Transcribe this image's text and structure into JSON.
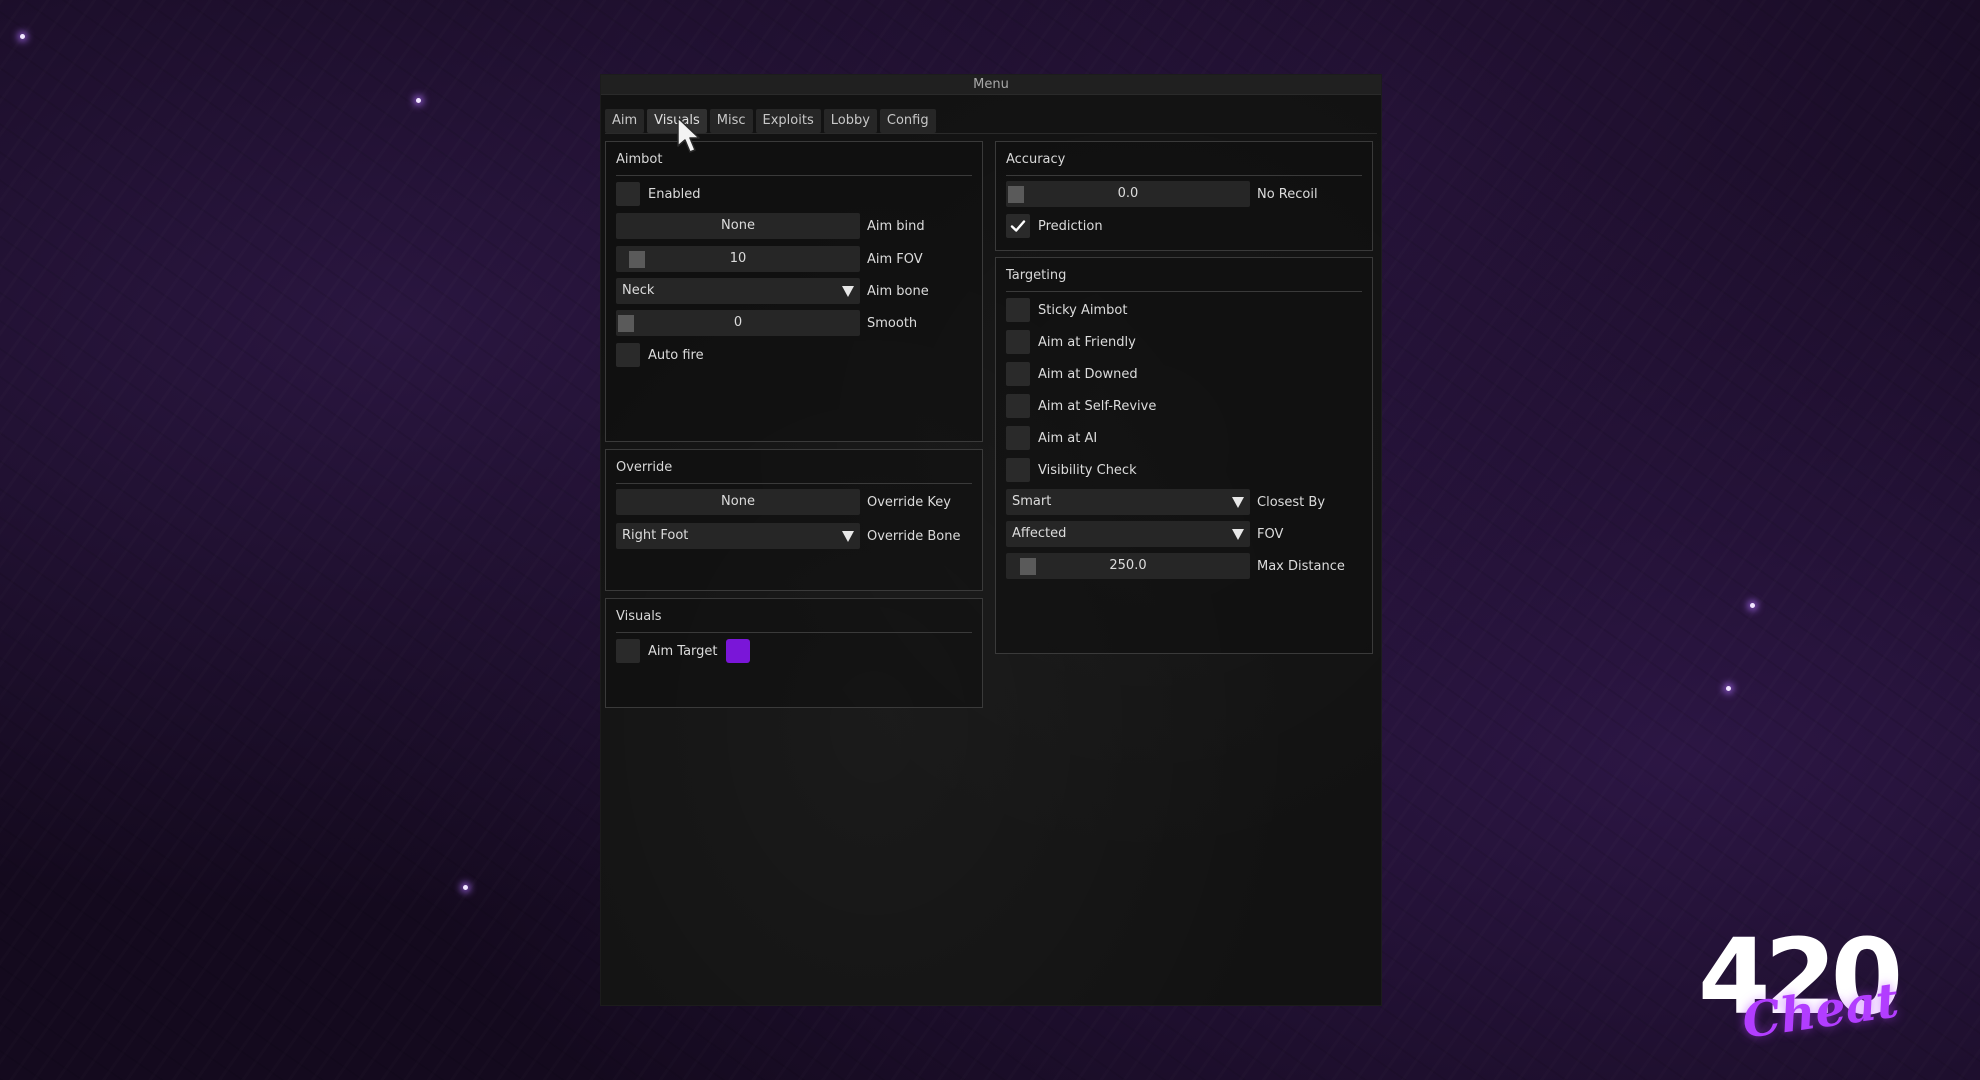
{
  "window": {
    "title": "Menu"
  },
  "tabs": [
    {
      "label": "Aim"
    },
    {
      "label": "Visuals"
    },
    {
      "label": "Misc"
    },
    {
      "label": "Exploits"
    },
    {
      "label": "Lobby"
    },
    {
      "label": "Config"
    }
  ],
  "aimbot": {
    "title": "Aimbot",
    "enabled": {
      "label": "Enabled",
      "checked": false
    },
    "aim_bind": {
      "value": "None",
      "label": "Aim bind"
    },
    "aim_fov": {
      "value": "10",
      "label": "Aim FOV"
    },
    "aim_bone": {
      "value": "Neck",
      "label": "Aim bone"
    },
    "smooth": {
      "value": "0",
      "label": "Smooth"
    },
    "auto_fire": {
      "label": "Auto fire",
      "checked": false
    }
  },
  "override": {
    "title": "Override",
    "override_key": {
      "value": "None",
      "label": "Override Key"
    },
    "override_bone": {
      "value": "Right Foot",
      "label": "Override Bone"
    }
  },
  "visuals": {
    "title": "Visuals",
    "aim_target": {
      "label": "Aim Target",
      "checked": false,
      "color": "#7a16d8"
    }
  },
  "accuracy": {
    "title": "Accuracy",
    "no_recoil": {
      "value": "0.0",
      "label": "No Recoil"
    },
    "prediction": {
      "label": "Prediction",
      "checked": true
    }
  },
  "targeting": {
    "title": "Targeting",
    "sticky_aimbot": {
      "label": "Sticky Aimbot",
      "checked": false
    },
    "aim_at_friendly": {
      "label": "Aim at Friendly",
      "checked": false
    },
    "aim_at_downed": {
      "label": "Aim at Downed",
      "checked": false
    },
    "aim_at_self_revive": {
      "label": "Aim at Self-Revive",
      "checked": false
    },
    "aim_at_ai": {
      "label": "Aim at AI",
      "checked": false
    },
    "visibility_check": {
      "label": "Visibility Check",
      "checked": false
    },
    "closest_by": {
      "value": "Smart",
      "label": "Closest By"
    },
    "fov": {
      "value": "Affected",
      "label": "FOV"
    },
    "max_distance": {
      "value": "250.0",
      "label": "Max Distance"
    }
  },
  "branding": {
    "number": "420",
    "script": "Cheat"
  },
  "colors": {
    "accent": "#7a16d8",
    "panel": "#121212",
    "control": "#262626"
  }
}
